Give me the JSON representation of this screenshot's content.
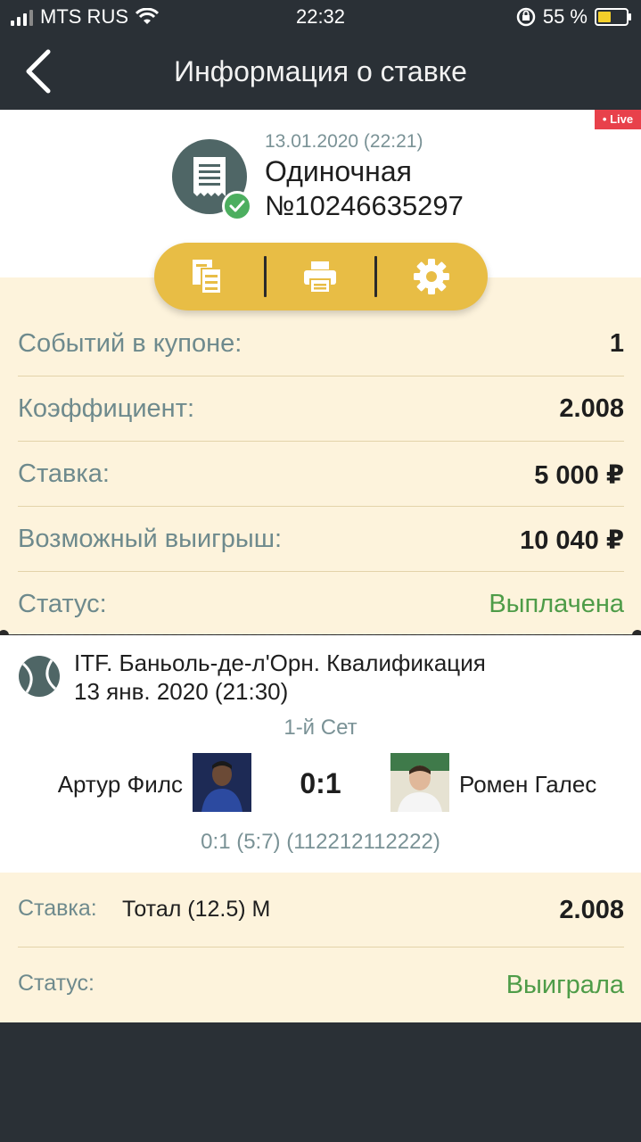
{
  "status_bar": {
    "carrier": "MTS RUS",
    "time": "22:32",
    "battery": "55 %",
    "battery_level": 0.55
  },
  "nav": {
    "title": "Информация о ставке"
  },
  "header": {
    "live_badge": "• Live",
    "date": "13.01.2020 (22:21)",
    "bet_type": "Одиночная",
    "bet_number": "№10246635297"
  },
  "actions": [
    {
      "icon": "document-copy-icon"
    },
    {
      "icon": "printer-icon"
    },
    {
      "icon": "gear-icon"
    }
  ],
  "details": [
    {
      "label": "Событий в купоне:",
      "value": "1"
    },
    {
      "label": "Коэффициент:",
      "value": "2.008"
    },
    {
      "label": "Ставка:",
      "value": "5 000 ₽"
    },
    {
      "label": "Возможный выигрыш:",
      "value": "10 040 ₽"
    },
    {
      "label": "Статус:",
      "value": "Выплачена"
    }
  ],
  "event": {
    "title": "ITF. Баньоль-де-л'Орн. Квалификация",
    "date": "13 янв. 2020 (21:30)",
    "period": "1-й Сет",
    "player1": "Артур Филс",
    "player2": "Ромен Галес",
    "score": "0:1",
    "set_details": "0:1 (5:7) (112212112222)"
  },
  "bet": {
    "stake_label": "Ставка:",
    "market": "Тотал (12.5) М",
    "odds": "2.008",
    "status_label": "Статус:",
    "status": "Выиграла"
  },
  "colors": {
    "dark": "#2a3036",
    "accent": "#e8bd45",
    "cream": "#fdf3dc",
    "green": "#4e9c48",
    "live_red": "#e8414b"
  }
}
